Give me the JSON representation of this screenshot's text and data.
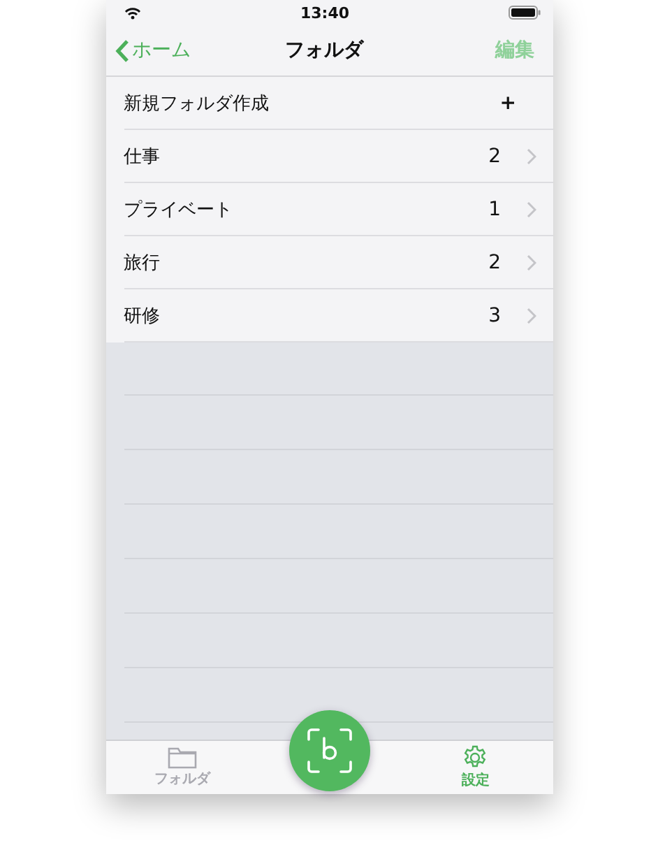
{
  "status_bar": {
    "time": "13:40"
  },
  "nav_bar": {
    "back": "ホーム",
    "title": "フォルダ",
    "edit": {
      "label": "編集",
      "disabled": true
    }
  },
  "rows": [
    {
      "kind": "action",
      "label": "新規フォルダ作成",
      "accessory": "+"
    },
    {
      "kind": "folder",
      "label": "仕事",
      "count": "2"
    },
    {
      "kind": "folder",
      "label": "プライベート",
      "count": "1"
    },
    {
      "kind": "folder",
      "label": "旅行",
      "count": "2"
    },
    {
      "kind": "folder",
      "label": "研修",
      "count": "3"
    }
  ],
  "tab_bar": {
    "tabs": [
      {
        "kind": "folder",
        "label": "フォルダ",
        "selected": false
      },
      {
        "kind": "settings",
        "label": "設定",
        "selected": true
      }
    ]
  }
}
